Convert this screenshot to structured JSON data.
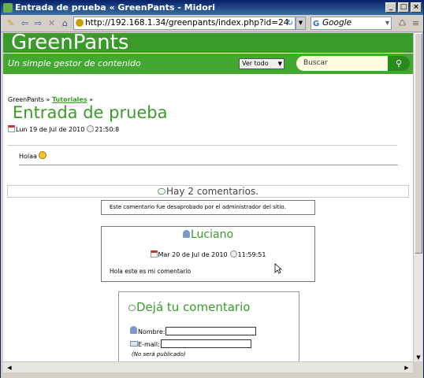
{
  "window": {
    "title": "Entrada de prueba « GreenPants - Midori"
  },
  "toolbar": {
    "url": "http://192.168.1.34/greenpants/index.php?id=24",
    "search_engine": "Google",
    "search_placeholder": "Google"
  },
  "site": {
    "title": "GreenPants",
    "tagline": "Un simple gestor de contenido",
    "filter_label": "Ver todo",
    "search_placeholder": "Buscar"
  },
  "breadcrumb": {
    "home": "GreenPants",
    "separator": "»",
    "section": "Tutoriales",
    "tail": "»"
  },
  "post": {
    "title": "Entrada de prueba",
    "date": "Lun 19 de Jul de 2010",
    "time": "21:50:8",
    "body": "Holaa"
  },
  "comments": {
    "header": "Hay 2 comentarios.",
    "items": [
      {
        "text": "Este comentario fue desaprobado por el administrador del sitio."
      },
      {
        "author": "Luciano",
        "date": "Mar 20 de Jul de 2010",
        "time": "11:59:51",
        "text": "Hola este es mi comentario"
      }
    ]
  },
  "reply": {
    "title": "Dejá tu comentario",
    "name_label": "Nombre:",
    "email_label": "E-mail:",
    "email_hint": "(No será publicado)"
  },
  "colors": {
    "brand_green": "#3a9a2a",
    "titlebar": "#0a246a"
  }
}
